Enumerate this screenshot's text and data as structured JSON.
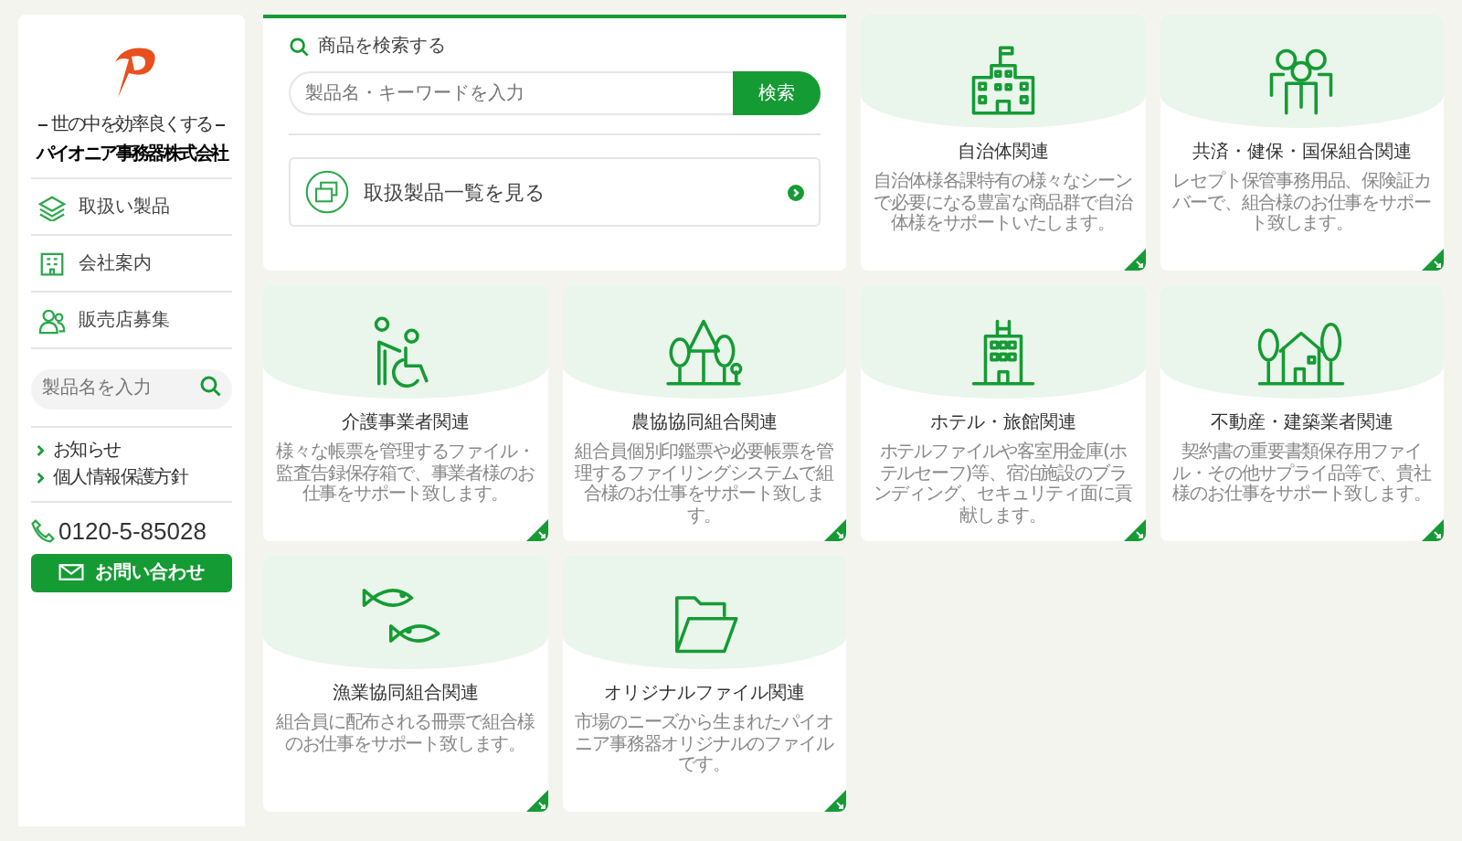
{
  "sidebar": {
    "tagline": "世の中を効率良くする",
    "company": "パイオニア事務器株式会社",
    "nav": [
      {
        "label": "取扱い製品"
      },
      {
        "label": "会社案内"
      },
      {
        "label": "販売店募集"
      }
    ],
    "search": {
      "placeholder": "製品名を入力"
    },
    "links": [
      "お知らせ",
      "個人情報保護方針"
    ],
    "phone": "0120-5-85028",
    "contact_button": "お問い合わせ"
  },
  "search_panel": {
    "heading": "商品を検索する",
    "placeholder": "製品名・キーワードを入力",
    "button": "検索",
    "catalog_link": "取扱製品一覧を見る"
  },
  "categories": [
    {
      "title": "自治体関連",
      "description": "自治体様各課特有の様々なシーンで必要になる豊富な商品群で自治体様をサポートいたします。"
    },
    {
      "title": "共済・健保・国保組合関連",
      "description": "レセプト保管事務用品、保険証カバーで、組合様のお仕事をサポート致します。"
    },
    {
      "title": "介護事業者関連",
      "description": "様々な帳票を管理するファイル・監査告録保存箱で、事業者様のお仕事をサポート致します。"
    },
    {
      "title": "農協協同組合関連",
      "description": "組合員個別印鑑票や必要帳票を管理するファイリングシステムで組合様のお仕事をサポート致します。"
    },
    {
      "title": "ホテル・旅館関連",
      "description": "ホテルファイルや客室用金庫(ホテルセーフ)等、宿泊施設のブランディング、セキュリティ面に貢献します。"
    },
    {
      "title": "不動産・建築業者関連",
      "description": "契約書の重要書類保存用ファイル・その他サプライ品等で、貴社様のお仕事をサポート致します。"
    },
    {
      "title": "漁業協同組合関連",
      "description": "組合員に配布される冊票で組合様のお仕事をサポート致します。"
    },
    {
      "title": "オリジナルファイル関連",
      "description": "市場のニーズから生まれたパイオニア事務器オリジナルのファイルです。"
    }
  ]
}
